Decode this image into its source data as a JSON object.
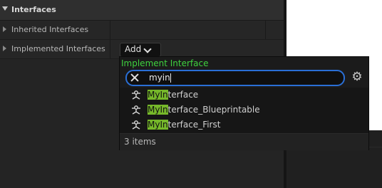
{
  "details": {
    "section_title": "Interfaces",
    "rows": [
      {
        "label": "Inherited Interfaces"
      },
      {
        "label": "Implemented Interfaces",
        "button_label": "Add"
      }
    ]
  },
  "popup": {
    "title": "Implement Interface",
    "search_value": "myin",
    "items": [
      {
        "match": "MyIn",
        "rest": "terface"
      },
      {
        "match": "MyIn",
        "rest": "terface_Blueprintable"
      },
      {
        "match": "MyIn",
        "rest": "terface_First"
      }
    ],
    "footer": "3 items"
  },
  "colors": {
    "title_green": "#3fd23f",
    "highlight": "#76b82a",
    "focus_blue": "#2a6fd6"
  },
  "icons": {
    "section": "chevron-down-icon",
    "row": "chevron-right-icon",
    "clear": "close-icon",
    "settings": "gear-icon",
    "item": "interface-icon"
  }
}
